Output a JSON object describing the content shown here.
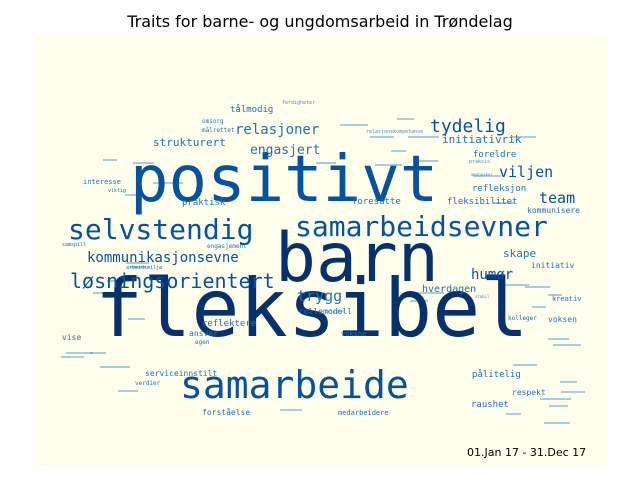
{
  "title": "Traits for barne- og ungdomsarbeid in Trøndelag",
  "date_range": "01.Jan 17 - 31.Dec 17",
  "colors": {
    "dark": "#08306b",
    "mid": "#08519c",
    "light": "#2171b5",
    "pale": "#4292c6",
    "background": "#fffeed"
  },
  "words": [
    {
      "text": "fleksibel",
      "tone": "dark"
    },
    {
      "text": "positivt",
      "tone": "mid"
    },
    {
      "text": "barn",
      "tone": "dark"
    },
    {
      "text": "samarbeide",
      "tone": "mid"
    },
    {
      "text": "samarbeidsevner",
      "tone": "mid"
    },
    {
      "text": "selvstendig",
      "tone": "mid"
    },
    {
      "text": "løsningsorientert",
      "tone": "mid"
    },
    {
      "text": "tydelig",
      "tone": "mid"
    },
    {
      "text": "kommunikasjonsevne",
      "tone": "mid"
    },
    {
      "text": "relasjoner",
      "tone": "light"
    },
    {
      "text": "engasjert",
      "tone": "light"
    },
    {
      "text": "trygg",
      "tone": "light"
    },
    {
      "text": "viljen",
      "tone": "mid"
    },
    {
      "text": "team",
      "tone": "mid"
    },
    {
      "text": "humør",
      "tone": "mid"
    },
    {
      "text": "initiativrik",
      "tone": "light"
    },
    {
      "text": "strukturert",
      "tone": "light"
    },
    {
      "text": "skape",
      "tone": "light"
    },
    {
      "text": "hverdagen",
      "tone": "light"
    },
    {
      "text": "tålmodig",
      "tone": "light"
    },
    {
      "text": "foreldre",
      "tone": "light"
    },
    {
      "text": "refleksjon",
      "tone": "light"
    },
    {
      "text": "fleksibilitet",
      "tone": "light"
    },
    {
      "text": "kommunisere",
      "tone": "light"
    },
    {
      "text": "foresatte",
      "tone": "light"
    },
    {
      "text": "praktisk",
      "tone": "light"
    },
    {
      "text": "pålitelig",
      "tone": "light"
    },
    {
      "text": "raushet",
      "tone": "light"
    },
    {
      "text": "respekt",
      "tone": "light"
    },
    {
      "text": "voksen",
      "tone": "light"
    },
    {
      "text": "kreativ",
      "tone": "light"
    },
    {
      "text": "initiativ",
      "tone": "light"
    },
    {
      "text": "interesse",
      "tone": "light"
    },
    {
      "text": "reflektere",
      "tone": "light"
    },
    {
      "text": "ansvar",
      "tone": "light"
    },
    {
      "text": "rollemodell",
      "tone": "light"
    },
    {
      "text": "voksne",
      "tone": "light"
    },
    {
      "text": "kolleger",
      "tone": "light"
    },
    {
      "text": "vise",
      "tone": "light"
    },
    {
      "text": "serviceinnstilt",
      "tone": "light"
    },
    {
      "text": "verdier",
      "tone": "light"
    },
    {
      "text": "forståelse",
      "tone": "light"
    },
    {
      "text": "medarbeidere",
      "tone": "light"
    },
    {
      "text": "omsorg",
      "tone": "light"
    },
    {
      "text": "målrettet",
      "tone": "light"
    },
    {
      "text": "egen",
      "tone": "light"
    },
    {
      "text": "engasjement",
      "tone": "light"
    },
    {
      "text": "arbeidsmiljø",
      "tone": "light"
    },
    {
      "text": "samspill",
      "tone": "light"
    },
    {
      "text": "viktig",
      "tone": "light"
    },
    {
      "text": "ferdigheter",
      "tone": "pale"
    },
    {
      "text": "relasjonskompetanse",
      "tone": "pale"
    },
    {
      "text": "mennesker",
      "tone": "pale"
    },
    {
      "text": "praksis",
      "tone": "pale"
    },
    {
      "text": "stabil",
      "tone": "pale"
    },
    {
      "text": "ærlighet",
      "tone": "pale"
    }
  ]
}
